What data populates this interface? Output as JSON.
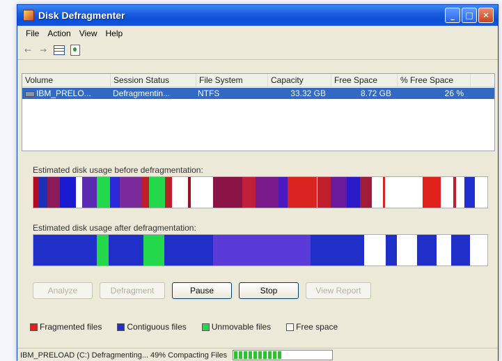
{
  "window": {
    "title": "Disk Defragmenter"
  },
  "menu": [
    "File",
    "Action",
    "View",
    "Help"
  ],
  "toolbar": {
    "back_icon": "back-arrow-icon",
    "forward_icon": "forward-arrow-icon",
    "grid_icon": "properties-grid-icon",
    "help_icon": "help-icon",
    "back_glyph": "←",
    "forward_glyph": "→"
  },
  "list": {
    "headers": [
      "Volume",
      "Session Status",
      "File System",
      "Capacity",
      "Free Space",
      "% Free Space"
    ],
    "rows": [
      {
        "volume": "IBM_PRELO...",
        "status": "Defragmentin...",
        "fs": "NTFS",
        "capacity": "33.32 GB",
        "free": "8.72 GB",
        "pct": "26 %"
      }
    ]
  },
  "before": {
    "label": "Estimated disk usage before defragmentation:",
    "segments": [
      {
        "s": 0.0,
        "e": 0.012,
        "c": "#b00a24"
      },
      {
        "s": 0.012,
        "e": 0.03,
        "c": "#1c2fb8"
      },
      {
        "s": 0.03,
        "e": 0.058,
        "c": "#8a1a5a"
      },
      {
        "s": 0.058,
        "e": 0.094,
        "c": "#1a1ad0"
      },
      {
        "s": 0.094,
        "e": 0.108,
        "c": "#ffffff"
      },
      {
        "s": 0.108,
        "e": 0.14,
        "c": "#5a2ab0"
      },
      {
        "s": 0.14,
        "e": 0.168,
        "c": "#23d84a"
      },
      {
        "s": 0.168,
        "e": 0.19,
        "c": "#2b2ad8"
      },
      {
        "s": 0.19,
        "e": 0.24,
        "c": "#7a2a9a"
      },
      {
        "s": 0.24,
        "e": 0.254,
        "c": "#c01e2a"
      },
      {
        "s": 0.254,
        "e": 0.29,
        "c": "#23d84a"
      },
      {
        "s": 0.29,
        "e": 0.305,
        "c": "#c01e2a"
      },
      {
        "s": 0.305,
        "e": 0.34,
        "c": "#ffffff"
      },
      {
        "s": 0.34,
        "e": 0.346,
        "c": "#a01020"
      },
      {
        "s": 0.346,
        "e": 0.395,
        "c": "#ffffff"
      },
      {
        "s": 0.395,
        "e": 0.46,
        "c": "#8a1446"
      },
      {
        "s": 0.46,
        "e": 0.49,
        "c": "#c01e3a"
      },
      {
        "s": 0.49,
        "e": 0.54,
        "c": "#7a1a8a"
      },
      {
        "s": 0.54,
        "e": 0.56,
        "c": "#4a1ac0"
      },
      {
        "s": 0.56,
        "e": 0.625,
        "c": "#d9231e"
      },
      {
        "s": 0.625,
        "e": 0.655,
        "c": "#c01e2a"
      },
      {
        "s": 0.655,
        "e": 0.69,
        "c": "#6a1a9a"
      },
      {
        "s": 0.69,
        "e": 0.72,
        "c": "#2a1ac8"
      },
      {
        "s": 0.72,
        "e": 0.745,
        "c": "#a01a3a"
      },
      {
        "s": 0.745,
        "e": 0.77,
        "c": "#ffffff"
      },
      {
        "s": 0.77,
        "e": 0.775,
        "c": "#d9231e"
      },
      {
        "s": 0.775,
        "e": 0.858,
        "c": "#ffffff"
      },
      {
        "s": 0.858,
        "e": 0.898,
        "c": "#e0201a"
      },
      {
        "s": 0.898,
        "e": 0.925,
        "c": "#ffffff"
      },
      {
        "s": 0.925,
        "e": 0.931,
        "c": "#c01e2a"
      },
      {
        "s": 0.931,
        "e": 0.95,
        "c": "#ffffff"
      },
      {
        "s": 0.95,
        "e": 0.972,
        "c": "#1f2fd0"
      },
      {
        "s": 0.972,
        "e": 1.0,
        "c": "#ffffff"
      }
    ]
  },
  "after": {
    "label": "Estimated disk usage after defragmentation:",
    "segments": [
      {
        "s": 0.0,
        "e": 0.14,
        "c": "#1f2fc8"
      },
      {
        "s": 0.14,
        "e": 0.165,
        "c": "#23d84a"
      },
      {
        "s": 0.165,
        "e": 0.242,
        "c": "#1f2fc8"
      },
      {
        "s": 0.242,
        "e": 0.288,
        "c": "#23d84a"
      },
      {
        "s": 0.288,
        "e": 0.395,
        "c": "#1f2fc8"
      },
      {
        "s": 0.395,
        "e": 0.61,
        "c": "#5a3ad8"
      },
      {
        "s": 0.61,
        "e": 0.728,
        "c": "#1f2fc8"
      },
      {
        "s": 0.728,
        "e": 0.776,
        "c": "#ffffff"
      },
      {
        "s": 0.776,
        "e": 0.8,
        "c": "#1f2fc8"
      },
      {
        "s": 0.8,
        "e": 0.845,
        "c": "#ffffff"
      },
      {
        "s": 0.845,
        "e": 0.888,
        "c": "#1f2fc8"
      },
      {
        "s": 0.888,
        "e": 0.92,
        "c": "#ffffff"
      },
      {
        "s": 0.92,
        "e": 0.962,
        "c": "#1f2fc8"
      },
      {
        "s": 0.962,
        "e": 1.0,
        "c": "#ffffff"
      }
    ]
  },
  "buttons": [
    {
      "label": "Analyze",
      "enabled": false
    },
    {
      "label": "Defragment",
      "enabled": false
    },
    {
      "label": "Pause",
      "enabled": true
    },
    {
      "label": "Stop",
      "enabled": true
    },
    {
      "label": "View Report",
      "enabled": false
    }
  ],
  "legend": [
    {
      "label": "Fragmented files",
      "color": "#e0201a"
    },
    {
      "label": "Contiguous files",
      "color": "#1f2fd0"
    },
    {
      "label": "Unmovable files",
      "color": "#23d84a"
    },
    {
      "label": "Free space",
      "color": "#ffffff"
    }
  ],
  "status": {
    "text": "IBM_PRELOAD (C:) Defragmenting... 49%  Compacting Files",
    "progress": 0.49
  }
}
